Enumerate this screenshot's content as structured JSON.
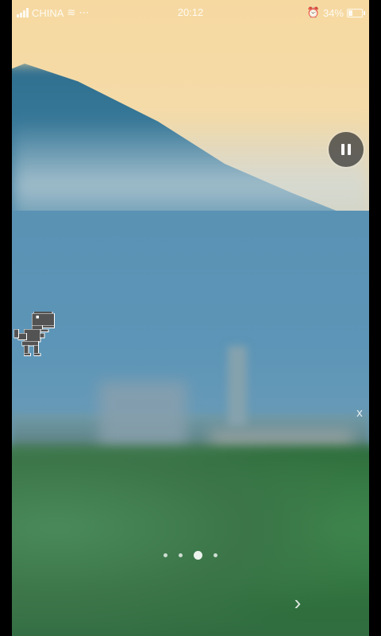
{
  "status_bar": {
    "carrier": "CHINA",
    "time": "20:12",
    "battery_text": "34%",
    "battery_level": 0.34,
    "icons": [
      "signal-icon",
      "wifi-icon",
      "alarm-icon",
      "battery-icon"
    ]
  },
  "controls": {
    "pause_caption": "",
    "close_label": "x",
    "next_label": "›"
  },
  "pager": {
    "count": 4,
    "active_index": 2
  },
  "colors": {
    "sky": "#f6d9a1",
    "water": "#5c95b7",
    "dino": "#535353"
  }
}
